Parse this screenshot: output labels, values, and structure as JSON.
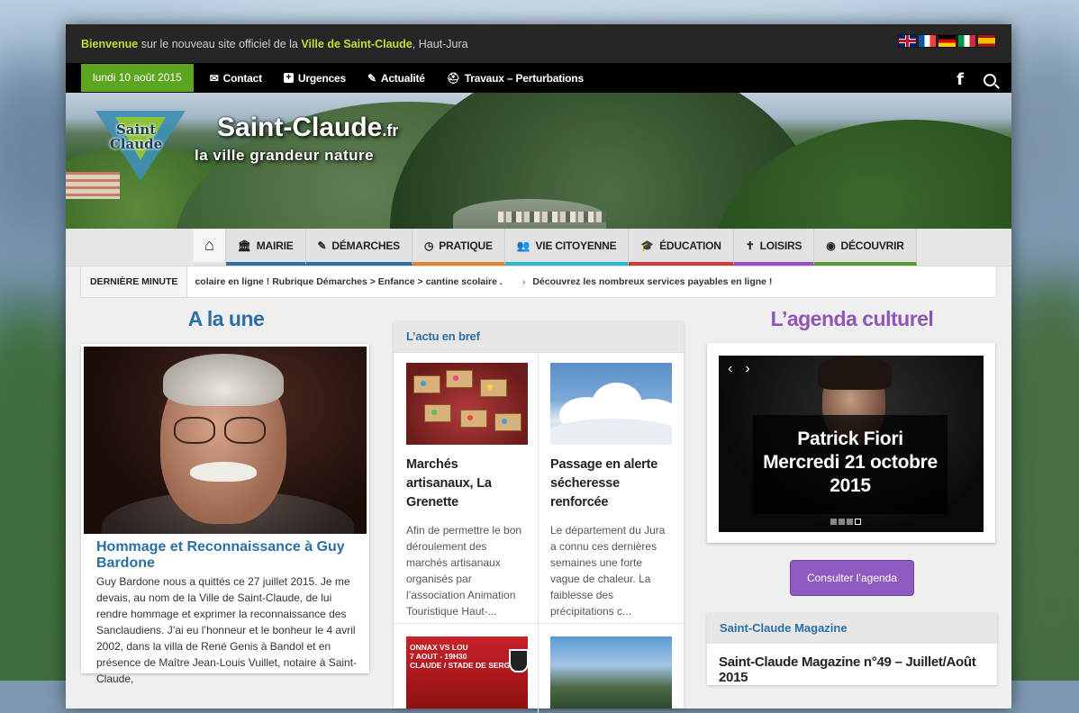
{
  "welcome": {
    "pre": "Bienvenue",
    "mid1": " sur le nouveau site officiel de la ",
    "city": "Ville de Saint-Claude",
    "post": ", Haut-Jura"
  },
  "languages": [
    "english-flag",
    "french-flag",
    "german-flag",
    "italian-flag",
    "spanish-flag"
  ],
  "topbar": {
    "date": "lundi 10 août 2015",
    "links": [
      {
        "label": "Contact",
        "icon": "envelope-icon"
      },
      {
        "label": "Urgences",
        "icon": "plus-square-icon"
      },
      {
        "label": "Actualité",
        "icon": "pencil-icon"
      },
      {
        "label": "Travaux – Perturbations",
        "icon": "worker-icon"
      }
    ],
    "facebook": "f"
  },
  "banner": {
    "logo_text": "Saint Claude",
    "title": "Saint-Claude",
    "title_suffix": ".fr",
    "subtitle": "la ville grandeur nature"
  },
  "mainnav": {
    "items": [
      {
        "label": "MAIRIE",
        "color": "#2c6ea6"
      },
      {
        "label": "DÉMARCHES",
        "color": "#2c6ea6"
      },
      {
        "label": "PRATIQUE",
        "color": "#e0872e"
      },
      {
        "label": "VIE CITOYENNE",
        "color": "#29b8d6"
      },
      {
        "label": "ÉDUCATION",
        "color": "#d03a3a"
      },
      {
        "label": "LOISIRS",
        "color": "#9a4fc4"
      },
      {
        "label": "DÉCOUVRIR",
        "color": "#5a9a2e"
      }
    ]
  },
  "ticker": {
    "label": "DERNIÈRE MINUTE",
    "item1": "colaire en ligne ! Rubrique Démarches > Enfance > cantine scolaire .",
    "item2": "Découvrez les nombreux services payables en ligne !"
  },
  "une": {
    "heading": "A la une",
    "title": "Hommage et Reconnaissance à Guy Bardone",
    "text": "Guy Bardone nous a quittés ce 27 juillet 2015. Je me devais, au nom de la Ville de Saint-Claude, de lui rendre hommage et exprimer la reconnaissance des Sanclaudiens. J’ai eu l’honneur et le bonheur le 4 avril 2002, dans la villa de René Genis à Bandol et en présence de Maître Jean-Louis Vuillet, notaire à Saint-Claude,"
  },
  "actu": {
    "heading": "L’actu en bref",
    "articles": [
      {
        "title": "Marchés artisanaux, La Grenette",
        "desc": "Afin de permettre le bon déroulement des marchés artisanaux organisés par l’association Animation Touristique Haut-..."
      },
      {
        "title": "Passage en alerte sécheresse renforcée",
        "desc": "Le département du Jura a connu ces dernières semaines une forte vague de chaleur. La faiblesse des précipitations c..."
      }
    ],
    "thumb3_text": "ONNAX VS LOU\n7 AOUT - 19H30\nCLAUDE / STADE DE SERGER"
  },
  "agenda": {
    "heading": "L’agenda culturel",
    "slide_caption": "Patrick Fiori\nMercredi 21 octobre\n2015",
    "prev": "‹",
    "next": "›",
    "button": "Consulter l’agenda"
  },
  "magazine": {
    "heading": "Saint-Claude Magazine",
    "title": "Saint-Claude Magazine n°49 – Juillet/Août 2015"
  }
}
